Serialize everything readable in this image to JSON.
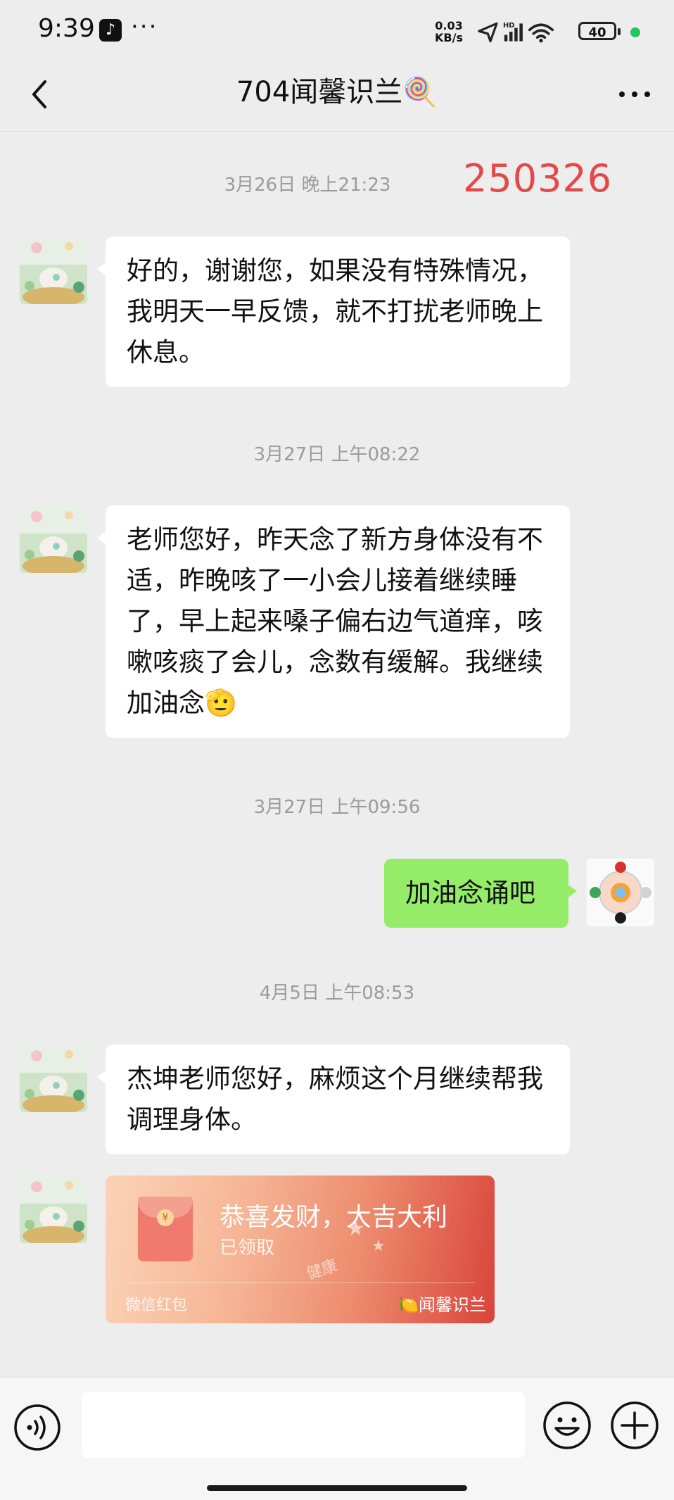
{
  "status_bar": {
    "time": "9:39",
    "more_dots": "···",
    "net_speed_value": "0.03",
    "net_speed_unit": "KB/s",
    "network_type": "HD",
    "battery": "40"
  },
  "header": {
    "title": "704闻馨识兰🍭",
    "back_icon": "chevron-left-icon",
    "more_icon": "more-horizontal-icon"
  },
  "annotation_code": "250326",
  "messages": [
    {
      "type": "timestamp",
      "text": "3月26日 晚上21:23"
    },
    {
      "type": "text",
      "side": "left",
      "text": "好的，谢谢您，如果没有特殊情况，我明天一早反馈，就不打扰老师晚上休息。"
    },
    {
      "type": "timestamp",
      "text": "3月27日 上午08:22"
    },
    {
      "type": "text",
      "side": "left",
      "text": "老师您好，昨天念了新方身体没有不适，昨晚咳了一小会儿接着继续睡了，早上起来嗓子偏右边气道痒，咳嗽咳痰了会儿，念数有缓解。我继续加油念🫡"
    },
    {
      "type": "timestamp",
      "text": "3月27日 上午09:56"
    },
    {
      "type": "text",
      "side": "right",
      "text": "加油念诵吧"
    },
    {
      "type": "timestamp",
      "text": "4月5日 上午08:53"
    },
    {
      "type": "text",
      "side": "left",
      "text": "杰坤老师您好，麻烦这个月继续帮我调理身体。"
    },
    {
      "type": "red_packet",
      "side": "left",
      "title": "恭喜发财，大吉大利",
      "status": "已领取",
      "footer_left": "微信红包",
      "footer_right": "🍋闻馨识兰",
      "deco_text": "健康"
    }
  ],
  "input_bar": {
    "text_value": "",
    "voice_icon": "voice-icon",
    "emoji_icon": "emoji-icon",
    "plus_icon": "plus-circle-icon"
  },
  "colors": {
    "background": "#ededed",
    "sent_bubble": "#95ec69",
    "received_bubble": "#ffffff",
    "timestamp_text": "#9b9b9b",
    "annotation_red": "#e54848"
  }
}
